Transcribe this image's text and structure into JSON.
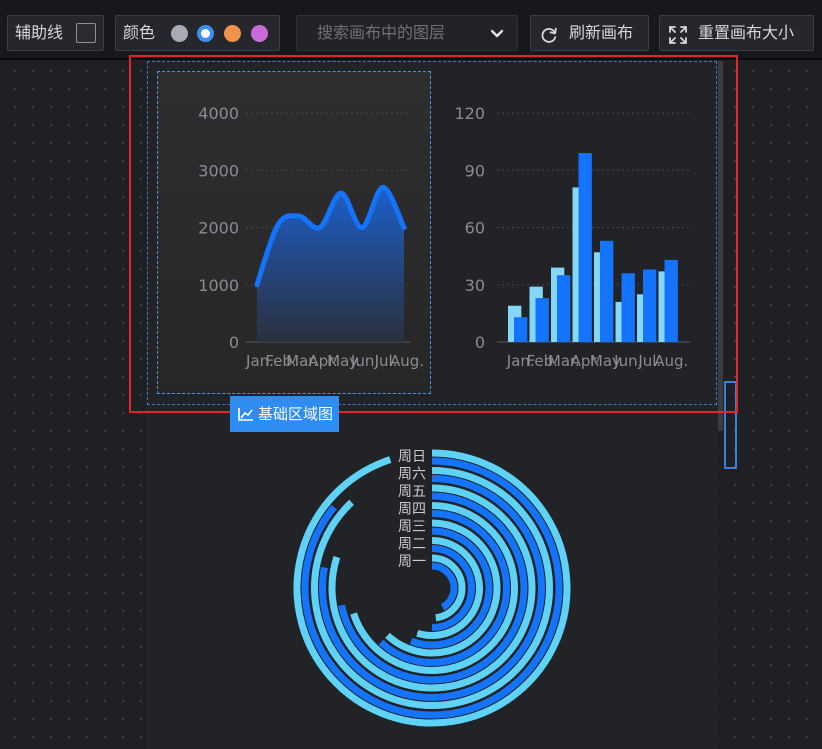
{
  "toolbar": {
    "guides_label": "辅助线",
    "guides_checked": false,
    "colors_label": "颜色",
    "color_swatches": [
      {
        "name": "gray",
        "color": "#a9abb3",
        "selected": false
      },
      {
        "name": "blue",
        "color": "#3e8ef7",
        "selected": true
      },
      {
        "name": "orange",
        "color": "#f0924a",
        "selected": false
      },
      {
        "name": "purple",
        "color": "#c86bd8",
        "selected": false
      }
    ],
    "search_placeholder": "搜索画布中的图层",
    "refresh_label": "刷新画布",
    "reset_label": "重置画布大小"
  },
  "canvas": {
    "selected_layer_label": "基础区域图"
  },
  "colors": {
    "accent": "#2f8cf0",
    "selection_red": "#e0262c",
    "series_blue": "#1473ff",
    "series_cyan": "#5fd3f7"
  },
  "chart_data": [
    {
      "type": "area",
      "categories": [
        "Jan.",
        "Feb.",
        "Mar.",
        "Apr.",
        "May.",
        "Jun.",
        "Jul.",
        "Aug."
      ],
      "values": [
        1000,
        2050,
        2200,
        2000,
        2600,
        2000,
        2700,
        2000
      ],
      "ylim": [
        0,
        4000
      ],
      "yticks": [
        0,
        1000,
        2000,
        3000,
        4000
      ],
      "grid": true,
      "color": "#1473ff"
    },
    {
      "type": "bar",
      "categories": [
        "Jan.",
        "Feb.",
        "Mar.",
        "Apr.",
        "May.",
        "Jun.",
        "Jul.",
        "Aug."
      ],
      "series": [
        {
          "values": [
            19,
            29,
            39,
            81,
            47,
            21,
            25,
            37
          ],
          "color": "#84d7f7"
        },
        {
          "values": [
            13,
            23,
            35,
            99,
            53,
            36,
            38,
            43
          ],
          "color": "#1473ff"
        }
      ],
      "ylim": [
        0,
        120
      ],
      "yticks": [
        0,
        30,
        60,
        90,
        120
      ],
      "grid": true
    },
    {
      "type": "radial-bar",
      "categories": [
        "周一",
        "周二",
        "周三",
        "周四",
        "周五",
        "周六",
        "周日"
      ],
      "series": [
        {
          "values": [
            0.42,
            0.5,
            0.56,
            0.62,
            0.72,
            0.78,
            0.86
          ],
          "color": "#1473ff"
        },
        {
          "values": [
            0.48,
            0.55,
            0.62,
            0.7,
            0.8,
            0.88,
            0.95
          ],
          "color": "#5fd3f7"
        }
      ],
      "max": 1
    }
  ]
}
